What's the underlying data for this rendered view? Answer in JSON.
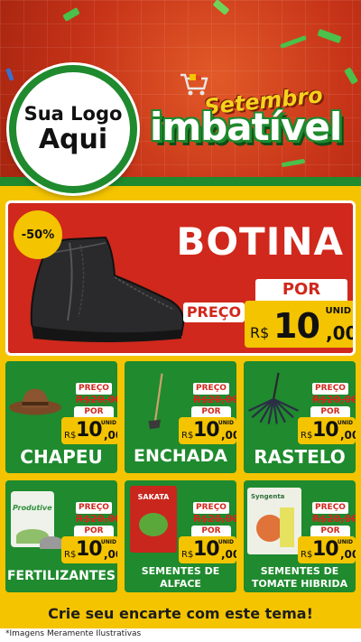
{
  "header": {
    "logo_line1": "Sua Logo",
    "logo_line2": "Aqui",
    "promo_top": "Setembro",
    "promo_main": "imbatível"
  },
  "featured": {
    "discount": "-50%",
    "title": "BOTINA",
    "old_label": "PREÇO",
    "old_price": "R$20,00",
    "por_label": "POR",
    "currency": "R$",
    "price_int": "10",
    "price_dec": ",00",
    "unit": "UNID"
  },
  "products": [
    {
      "name": "CHAPEU",
      "old_label": "PREÇO",
      "old_price": "R$20,00",
      "por_label": "POR",
      "currency": "R$",
      "price_int": "10",
      "price_dec": ",00",
      "unit": "UNID"
    },
    {
      "name": "ENCHADA",
      "old_label": "PREÇO",
      "old_price": "R$20,00",
      "por_label": "POR",
      "currency": "R$",
      "price_int": "10",
      "price_dec": ",00",
      "unit": "UNID"
    },
    {
      "name": "RASTELO",
      "old_label": "PREÇO",
      "old_price": "R$20,00",
      "por_label": "POR",
      "currency": "R$",
      "price_int": "10",
      "price_dec": ",00",
      "unit": "UNID"
    },
    {
      "name": "FERTILIZANTES",
      "old_label": "PREÇO",
      "old_price": "R$20,00",
      "por_label": "POR",
      "currency": "R$",
      "price_int": "10",
      "price_dec": ",00",
      "unit": "UNID",
      "package_text": "Produtive"
    },
    {
      "name_line1": "SEMENTES DE",
      "name_line2": "ALFACE",
      "old_label": "PREÇO",
      "old_price": "R$20,00",
      "por_label": "POR",
      "currency": "R$",
      "price_int": "10",
      "price_dec": ",00",
      "unit": "UNID",
      "package_text": "SAKATA"
    },
    {
      "name_line1": "SEMENTES DE",
      "name_line2": "TOMATE HIBRIDA",
      "old_label": "PREÇO",
      "old_price": "R$20,00",
      "por_label": "POR",
      "currency": "R$",
      "price_int": "10",
      "price_dec": ",00",
      "unit": "UNID",
      "package_text": "Syngenta"
    }
  ],
  "footer": {
    "cta": "Crie seu encarte com este tema!",
    "disclaimer": "*Imagens Meramente Ilustrativas"
  },
  "colors": {
    "red": "#d0281c",
    "green": "#1f8a2e",
    "yellow": "#f4c400"
  }
}
